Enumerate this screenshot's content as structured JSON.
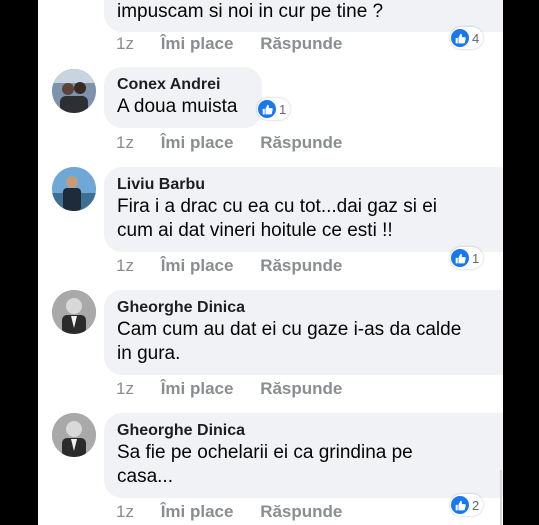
{
  "colors": {
    "accent": "#1877f2",
    "bubble": "#f0f2f5",
    "meta": "#8a8d91"
  },
  "comments": [
    {
      "author": "",
      "lines": [
        "impuscam si noi in cur pe tine ?"
      ],
      "time": "1z",
      "like_label": "Îmi place",
      "reply_label": "Răspunde",
      "reactions": "4",
      "reaction_icon": "like-icon"
    },
    {
      "author": "Conex Andrei",
      "lines": [
        "A doua muista"
      ],
      "time": "1z",
      "like_label": "Îmi place",
      "reply_label": "Răspunde",
      "reactions": "1",
      "reaction_icon": "like-icon"
    },
    {
      "author": "Liviu Barbu",
      "lines": [
        "Fira i a drac cu ea cu tot...dai gaz si ei",
        "cum ai dat vineri hoitule ce esti !!"
      ],
      "time": "1z",
      "like_label": "Îmi place",
      "reply_label": "Răspunde",
      "reactions": "1",
      "reaction_icon": "like-icon"
    },
    {
      "author": "Gheorghe Dinica",
      "lines": [
        "Cam cum au dat ei cu gaze i-as da calde",
        "in gura."
      ],
      "time": "1z",
      "like_label": "Îmi place",
      "reply_label": "Răspunde",
      "reactions": "",
      "reaction_icon": ""
    },
    {
      "author": "Gheorghe Dinica",
      "lines": [
        "Sa fie pe ochelarii ei ca grindina pe",
        "casa..."
      ],
      "time": "1z",
      "like_label": "Îmi place",
      "reply_label": "Răspunde",
      "reactions": "2",
      "reaction_icon": "like-icon"
    }
  ]
}
